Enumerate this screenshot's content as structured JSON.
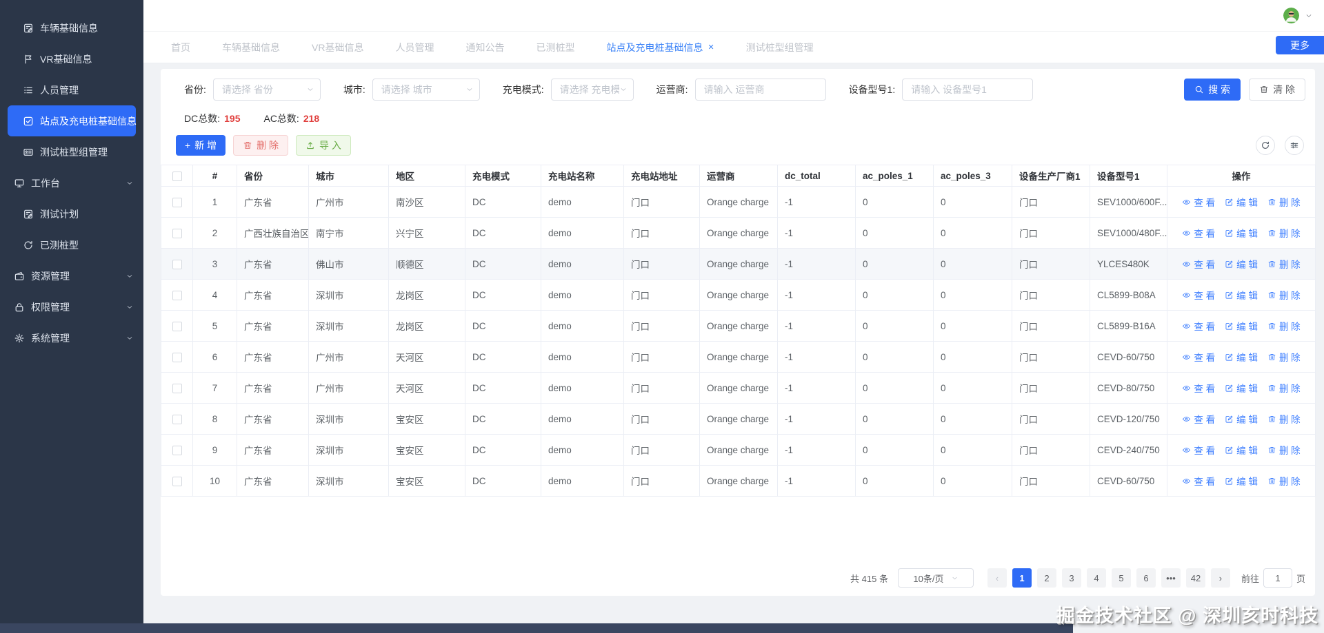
{
  "app": {
    "more_button": "更多",
    "watermark": "掘金技术社区 @ 深圳亥时科技"
  },
  "theme": {
    "accent": "#2e6bf6",
    "stat_red": "#e03e3c",
    "sidebar_bg": "#2b3648"
  },
  "sidebar": {
    "items": [
      {
        "label": "车辆基础信息",
        "icon": "doc-edit-icon",
        "level": 2,
        "active": false,
        "chevron": false
      },
      {
        "label": "VR基础信息",
        "icon": "flag-icon",
        "level": 2,
        "active": false,
        "chevron": false
      },
      {
        "label": "人员管理",
        "icon": "list-icon",
        "level": 2,
        "active": false,
        "chevron": false
      },
      {
        "label": "站点及充电桩基础信息",
        "icon": "checkbox-icon",
        "level": 2,
        "active": true,
        "chevron": false
      },
      {
        "label": "测试桩型组管理",
        "icon": "id-card-icon",
        "level": 2,
        "active": false,
        "chevron": false
      },
      {
        "label": "工作台",
        "icon": "monitor-icon",
        "level": 1,
        "active": false,
        "chevron": true
      },
      {
        "label": "测试计划",
        "icon": "doc-edit-icon",
        "level": 2,
        "active": false,
        "chevron": false
      },
      {
        "label": "已测桩型",
        "icon": "refresh-icon",
        "level": 2,
        "active": false,
        "chevron": false
      },
      {
        "label": "资源管理",
        "icon": "wallet-icon",
        "level": 1,
        "active": false,
        "chevron": true
      },
      {
        "label": "权限管理",
        "icon": "lock-icon",
        "level": 1,
        "active": false,
        "chevron": true
      },
      {
        "label": "系统管理",
        "icon": "gear-icon",
        "level": 1,
        "active": false,
        "chevron": true
      }
    ]
  },
  "tabs": {
    "items": [
      {
        "label": "首页",
        "active": false,
        "closable": false
      },
      {
        "label": "车辆基础信息",
        "active": false,
        "closable": false
      },
      {
        "label": "VR基础信息",
        "active": false,
        "closable": false
      },
      {
        "label": "人员管理",
        "active": false,
        "closable": false
      },
      {
        "label": "通知公告",
        "active": false,
        "closable": false
      },
      {
        "label": "已测桩型",
        "active": false,
        "closable": false
      },
      {
        "label": "站点及充电桩基础信息",
        "active": true,
        "closable": true
      },
      {
        "label": "测试桩型组管理",
        "active": false,
        "closable": false
      }
    ],
    "close_glyph": "✕"
  },
  "filters": {
    "fields": [
      {
        "label": "省份:",
        "placeholder": "请选择 省份",
        "type": "select"
      },
      {
        "label": "城市:",
        "placeholder": "请选择 城市",
        "type": "select"
      },
      {
        "label": "充电模式:",
        "placeholder": "请选择 充电模式",
        "type": "select"
      },
      {
        "label": "运营商:",
        "placeholder": "请输入 运营商",
        "type": "input"
      },
      {
        "label": "设备型号1:",
        "placeholder": "请输入 设备型号1",
        "type": "input"
      }
    ],
    "search_label": "搜 索",
    "clear_label": "清 除"
  },
  "stats": {
    "dc_label": "DC总数:",
    "dc_value": "195",
    "ac_label": "AC总数:",
    "ac_value": "218"
  },
  "toolbar": {
    "add_label": "新 增",
    "add_plus": "+",
    "delete_label": "删 除",
    "import_label": "导 入"
  },
  "table": {
    "columns": [
      "#",
      "省份",
      "城市",
      "地区",
      "充电模式",
      "充电站名称",
      "充电站地址",
      "运营商",
      "dc_total",
      "ac_poles_1",
      "ac_poles_3",
      "设备生产厂商1",
      "设备型号1",
      "操作"
    ],
    "rows": [
      [
        "1",
        "广东省",
        "广州市",
        "南沙区",
        "DC",
        "demo",
        "门口",
        "Orange charge",
        "-1",
        "0",
        "0",
        "门口",
        "SEV1000/600F..."
      ],
      [
        "2",
        "广西壮族自治区",
        "南宁市",
        "兴宁区",
        "DC",
        "demo",
        "门口",
        "Orange charge",
        "-1",
        "0",
        "0",
        "门口",
        "SEV1000/480F..."
      ],
      [
        "3",
        "广东省",
        "佛山市",
        "顺德区",
        "DC",
        "demo",
        "门口",
        "Orange charge",
        "-1",
        "0",
        "0",
        "门口",
        "YLCES480K"
      ],
      [
        "4",
        "广东省",
        "深圳市",
        "龙岗区",
        "DC",
        "demo",
        "门口",
        "Orange charge",
        "-1",
        "0",
        "0",
        "门口",
        "CL5899-B08A"
      ],
      [
        "5",
        "广东省",
        "深圳市",
        "龙岗区",
        "DC",
        "demo",
        "门口",
        "Orange charge",
        "-1",
        "0",
        "0",
        "门口",
        "CL5899-B16A"
      ],
      [
        "6",
        "广东省",
        "广州市",
        "天河区",
        "DC",
        "demo",
        "门口",
        "Orange charge",
        "-1",
        "0",
        "0",
        "门口",
        "CEVD-60/750"
      ],
      [
        "7",
        "广东省",
        "广州市",
        "天河区",
        "DC",
        "demo",
        "门口",
        "Orange charge",
        "-1",
        "0",
        "0",
        "门口",
        "CEVD-80/750"
      ],
      [
        "8",
        "广东省",
        "深圳市",
        "宝安区",
        "DC",
        "demo",
        "门口",
        "Orange charge",
        "-1",
        "0",
        "0",
        "门口",
        "CEVD-120/750"
      ],
      [
        "9",
        "广东省",
        "深圳市",
        "宝安区",
        "DC",
        "demo",
        "门口",
        "Orange charge",
        "-1",
        "0",
        "0",
        "门口",
        "CEVD-240/750"
      ],
      [
        "10",
        "广东省",
        "深圳市",
        "宝安区",
        "DC",
        "demo",
        "门口",
        "Orange charge",
        "-1",
        "0",
        "0",
        "门口",
        "CEVD-60/750"
      ]
    ],
    "highlighted_row_index": 2,
    "actions": [
      {
        "label": "查 看",
        "icon": "eye-icon",
        "name": "view-link"
      },
      {
        "label": "编 辑",
        "icon": "edit-icon",
        "name": "edit-link"
      },
      {
        "label": "删 除",
        "icon": "trash-icon",
        "name": "delete-link"
      }
    ]
  },
  "pagination": {
    "total_label": "共 415 条",
    "page_size": "10条/页",
    "pages": [
      "1",
      "2",
      "3",
      "4",
      "5",
      "6",
      "•••",
      "42"
    ],
    "active_page": "1",
    "prev_glyph": "‹",
    "next_glyph": "›",
    "goto_label": "前往",
    "goto_value": "1",
    "page_unit": "页"
  }
}
